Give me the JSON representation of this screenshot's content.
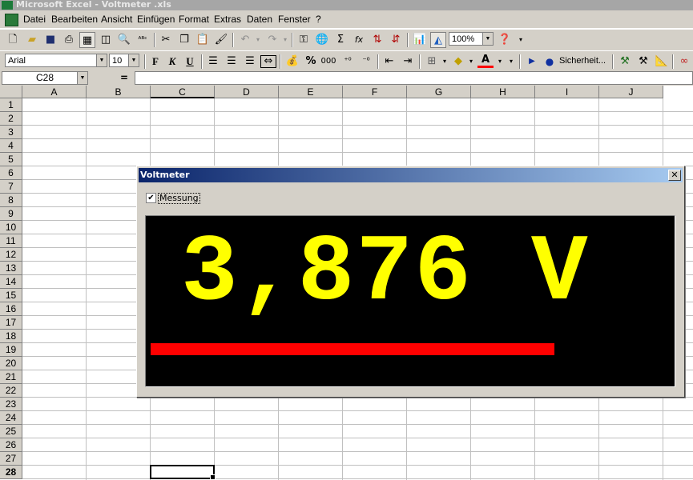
{
  "window": {
    "title": "Microsoft Excel - Voltmeter .xls"
  },
  "menu": [
    "Datei",
    "Bearbeiten",
    "Ansicht",
    "Einfügen",
    "Format",
    "Extras",
    "Daten",
    "Fenster",
    "?"
  ],
  "toolbar1": {
    "zoom": "100%"
  },
  "toolbar2": {
    "font": "Arial",
    "size": "10",
    "bold": "F",
    "italic": "K",
    "underline": "U",
    "percent": "%",
    "thousands": "000",
    "security": "Sicherheit..."
  },
  "formula": {
    "cell": "C28",
    "equals": "="
  },
  "sheet": {
    "columns": [
      "A",
      "B",
      "C",
      "D",
      "E",
      "F",
      "G",
      "H",
      "I",
      "J"
    ],
    "rows": [
      "1",
      "2",
      "3",
      "4",
      "5",
      "6",
      "7",
      "8",
      "9",
      "10",
      "11",
      "12",
      "13",
      "14",
      "15",
      "16",
      "17",
      "18",
      "19",
      "20",
      "21",
      "22",
      "23",
      "24",
      "25",
      "26",
      "27",
      "28"
    ],
    "active_column": "C",
    "active_row": "28"
  },
  "dialog": {
    "title": "Voltmeter",
    "checkbox_label": "Messung",
    "checkbox_checked": true,
    "reading": "3,876 V",
    "level_fraction": 0.775,
    "level_color": "#ff0000",
    "reading_color": "#ffff00"
  }
}
